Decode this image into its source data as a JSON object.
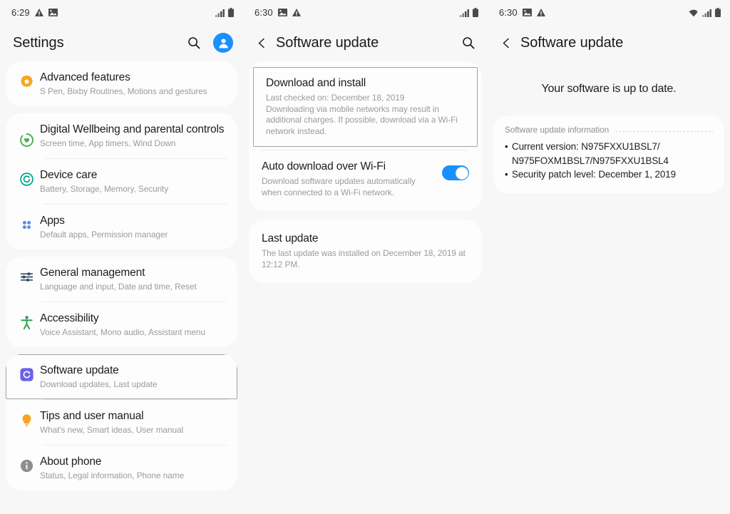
{
  "panels": {
    "settings": {
      "statusbar": {
        "time": "6:29",
        "left_icons": [
          "warning-triangle-icon",
          "image-icon"
        ],
        "right_icons": [
          "signal-bars-icon",
          "battery-icon"
        ]
      },
      "appbar": {
        "title": "Settings",
        "search_icon": "search-icon",
        "avatar_icon": "account-avatar-icon"
      },
      "groups": [
        {
          "items": [
            {
              "icon": "advanced-features-gear-icon",
              "icon_color": "#f5a623",
              "title": "Advanced features",
              "subtitle": "S Pen, Bixby Routines, Motions and gestures",
              "focused": false
            }
          ]
        },
        {
          "items": [
            {
              "icon": "digital-wellbeing-heart-icon",
              "icon_color": "#4caf50",
              "title": "Digital Wellbeing and parental controls",
              "subtitle": "Screen time, App timers, Wind Down",
              "focused": false
            },
            {
              "icon": "device-care-icon",
              "icon_color": "#00a88f",
              "title": "Device care",
              "subtitle": "Battery, Storage, Memory, Security",
              "focused": false
            },
            {
              "icon": "apps-grid-icon",
              "icon_color": "#5b8def",
              "title": "Apps",
              "subtitle": "Default apps, Permission manager",
              "focused": false
            }
          ]
        },
        {
          "items": [
            {
              "icon": "general-management-sliders-icon",
              "icon_color": "#33495e",
              "title": "General management",
              "subtitle": "Language and input, Date and time, Reset",
              "focused": false
            },
            {
              "icon": "accessibility-person-icon",
              "icon_color": "#2e9e4f",
              "title": "Accessibility",
              "subtitle": "Voice Assistant, Mono audio, Assistant menu",
              "focused": false
            }
          ]
        },
        {
          "items": [
            {
              "icon": "software-update-refresh-icon",
              "icon_color": "#6b62e8",
              "title": "Software update",
              "subtitle": "Download updates, Last update",
              "focused": true
            },
            {
              "icon": "tips-lightbulb-icon",
              "icon_color": "#f5a623",
              "title": "Tips and user manual",
              "subtitle": "What's new, Smart ideas, User manual",
              "focused": false
            },
            {
              "icon": "about-phone-info-icon",
              "icon_color": "#8e8e8e",
              "title": "About phone",
              "subtitle": "Status, Legal information, Phone name",
              "focused": false
            }
          ]
        }
      ]
    },
    "software_update": {
      "statusbar": {
        "time": "6:30",
        "left_icons": [
          "image-icon",
          "warning-triangle-icon"
        ],
        "right_icons": [
          "signal-bars-icon",
          "battery-icon"
        ]
      },
      "appbar": {
        "back_icon": "back-chevron-icon",
        "title": "Software update",
        "search_icon": "search-icon"
      },
      "download_and_install": {
        "title": "Download and install",
        "line1": "Last checked on: December 18, 2019",
        "line2": "Downloading via mobile networks may result in additional charges. If possible, download via a Wi-Fi network instead.",
        "focused": true
      },
      "auto_download": {
        "title": "Auto download over Wi-Fi",
        "subtitle": "Download software updates automatically when connected to a Wi-Fi network.",
        "toggle_on": true,
        "toggle_color": "#1a8fff"
      },
      "last_update": {
        "title": "Last update",
        "subtitle": "The last update was installed on December 18, 2019 at 12:12 PM."
      }
    },
    "up_to_date": {
      "statusbar": {
        "time": "6:30",
        "left_icons": [
          "image-icon",
          "warning-triangle-icon"
        ],
        "right_icons": [
          "wifi-icon",
          "signal-bars-icon",
          "battery-icon"
        ]
      },
      "appbar": {
        "back_icon": "back-chevron-icon",
        "title": "Software update"
      },
      "status_message": "Your software is up to date.",
      "info": {
        "heading": "Software update information",
        "items": [
          {
            "line1": "Current version: N975FXXU1BSL7/",
            "line2": "N975FOXM1BSL7/N975FXXU1BSL4"
          },
          {
            "line1": "Security patch level: December 1, 2019",
            "line2": ""
          }
        ]
      }
    }
  }
}
